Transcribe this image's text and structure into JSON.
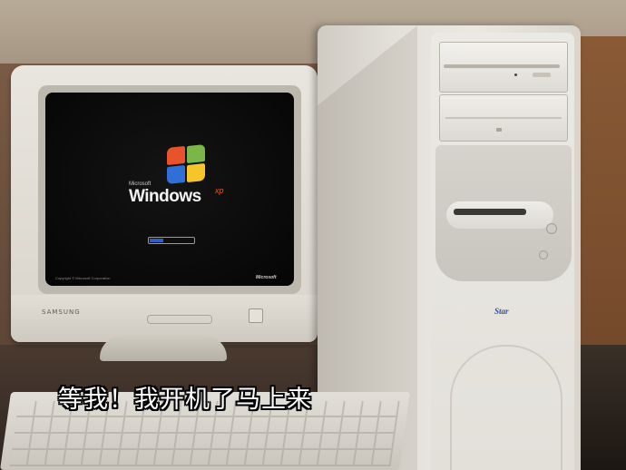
{
  "photo": {
    "description_colors": {
      "accent": "#e55a1b",
      "progress": "#2e5ec9"
    }
  },
  "boot_screen": {
    "brand_small": "Microsoft",
    "brand_word": "Windows",
    "brand_suffix": "xp",
    "copyright": "Copyright © Microsoft Corporation",
    "corner_logo": "Microsoft"
  },
  "monitor": {
    "brand": "SAMSUNG"
  },
  "tower": {
    "sticker": "Star"
  },
  "caption": {
    "text": "等我！我开机了马上来"
  }
}
